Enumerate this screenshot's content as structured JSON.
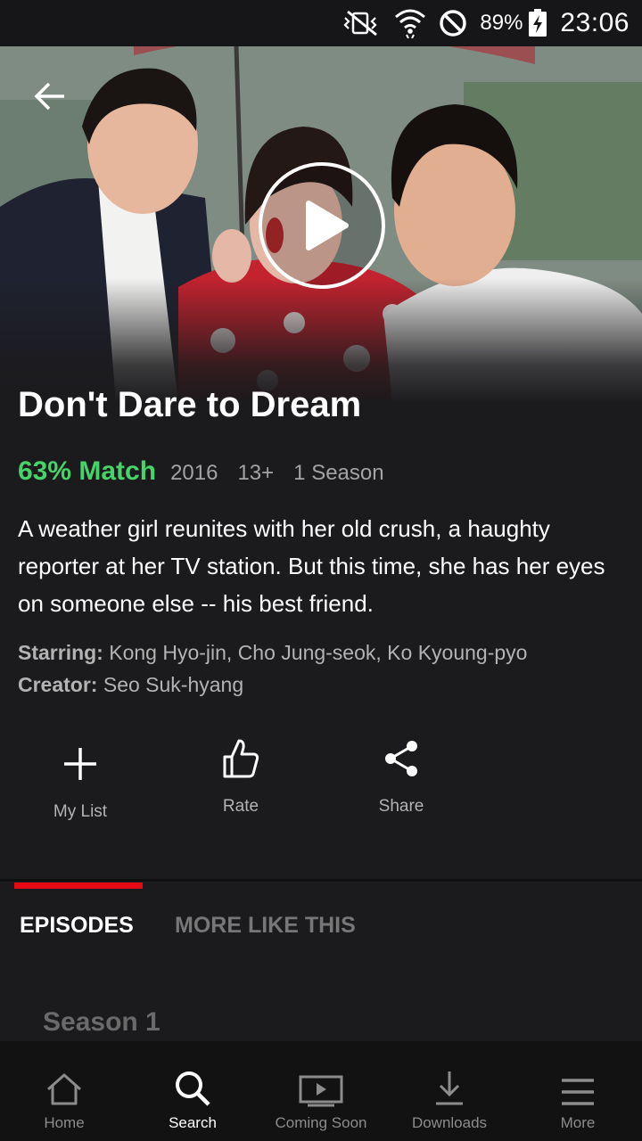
{
  "status_bar": {
    "battery": "89%",
    "time": "23:06",
    "icons": [
      "vibrate-mute-icon",
      "wifi-icon",
      "do-not-disturb-icon",
      "battery-charging-icon"
    ]
  },
  "hero": {
    "back_icon": "arrow-left-icon",
    "play_icon": "play-icon"
  },
  "show": {
    "title": "Don't Dare to Dream",
    "match": "63% Match",
    "year": "2016",
    "rating": "13+",
    "seasons": "1 Season",
    "synopsis": "A weather girl reunites with her old crush, a haughty reporter at her TV station. But this time, she has her eyes on someone else -- his best friend.",
    "starring_label": "Starring:",
    "starring": "Kong Hyo-jin, Cho Jung-seok, Ko Kyoung-pyo",
    "creator_label": "Creator:",
    "creator": "Seo Suk-hyang"
  },
  "actions": [
    {
      "label": "My List",
      "icon": "plus-icon"
    },
    {
      "label": "Rate",
      "icon": "thumbs-up-icon"
    },
    {
      "label": "Share",
      "icon": "share-icon"
    }
  ],
  "tabs": [
    {
      "label": "EPISODES",
      "active": true
    },
    {
      "label": "MORE LIKE THIS",
      "active": false
    }
  ],
  "season_selector": "Season 1",
  "bottom_nav": [
    {
      "label": "Home",
      "icon": "home-icon",
      "active": false
    },
    {
      "label": "Search",
      "icon": "search-icon",
      "active": true
    },
    {
      "label": "Coming Soon",
      "icon": "coming-soon-icon",
      "active": false
    },
    {
      "label": "Downloads",
      "icon": "download-icon",
      "active": false
    },
    {
      "label": "More",
      "icon": "menu-icon",
      "active": false
    }
  ],
  "colors": {
    "background": "#1b1a1c",
    "match_green": "#46d369",
    "accent_red": "#e50914",
    "muted_text": "#a3a3a3"
  }
}
